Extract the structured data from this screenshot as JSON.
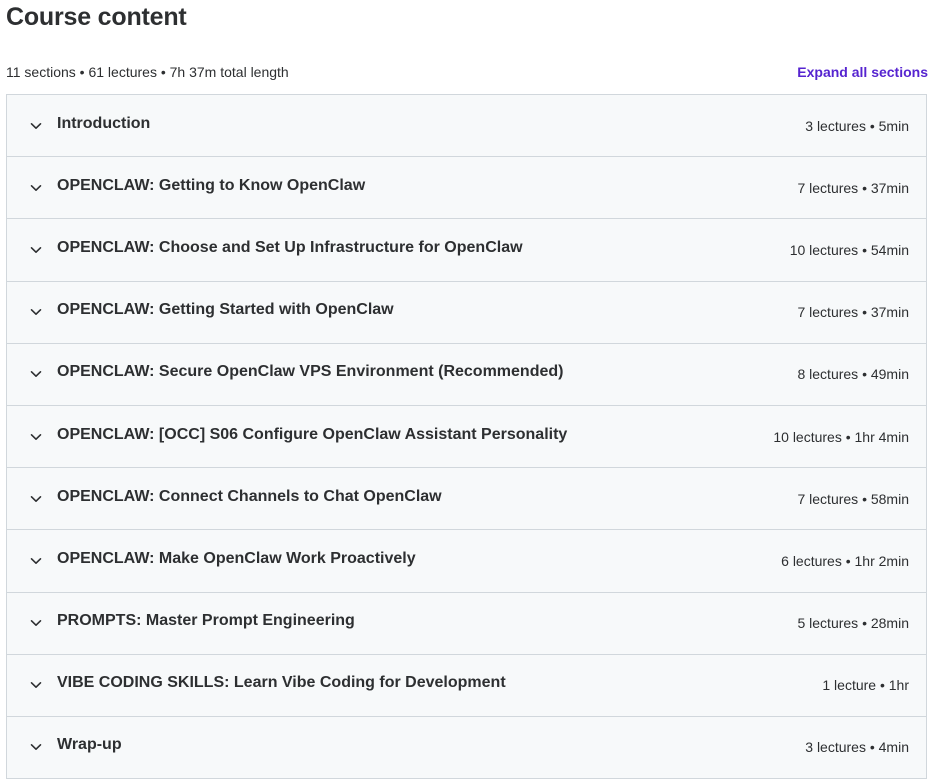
{
  "header": {
    "title": "Course content",
    "summary": "11 sections • 61 lectures • 7h 37m total length",
    "expand_label": "Expand all sections"
  },
  "colors": {
    "accent": "#5624d0",
    "section_bg": "#f7f9fa",
    "border": "#d1d7dc",
    "text": "#2d2f31"
  },
  "sections": [
    {
      "title": "Introduction",
      "meta": "3 lectures • 5min",
      "icon": "chevron-down-icon"
    },
    {
      "title": "OPENCLAW: Getting to Know OpenClaw",
      "meta": "7 lectures • 37min",
      "icon": "chevron-down-icon"
    },
    {
      "title": "OPENCLAW: Choose and Set Up Infrastructure for OpenClaw",
      "meta": "10 lectures • 54min",
      "icon": "chevron-down-icon"
    },
    {
      "title": "OPENCLAW: Getting Started with OpenClaw",
      "meta": "7 lectures • 37min",
      "icon": "chevron-down-icon"
    },
    {
      "title": "OPENCLAW: Secure OpenClaw VPS Environment (Recommended)",
      "meta": "8 lectures • 49min",
      "icon": "chevron-down-icon"
    },
    {
      "title": "OPENCLAW: [OCC] S06 Configure OpenClaw Assistant Personality",
      "meta": "10 lectures • 1hr 4min",
      "icon": "chevron-down-icon"
    },
    {
      "title": "OPENCLAW: Connect Channels to Chat OpenClaw",
      "meta": "7 lectures • 58min",
      "icon": "chevron-down-icon"
    },
    {
      "title": "OPENCLAW: Make OpenClaw Work Proactively",
      "meta": "6 lectures • 1hr 2min",
      "icon": "chevron-down-icon"
    },
    {
      "title": "PROMPTS: Master Prompt Engineering",
      "meta": "5 lectures • 28min",
      "icon": "chevron-down-icon"
    },
    {
      "title": "VIBE CODING SKILLS: Learn Vibe Coding for Development",
      "meta": "1 lecture • 1hr",
      "icon": "chevron-down-icon"
    },
    {
      "title": "Wrap-up",
      "meta": "3 lectures • 4min",
      "icon": "chevron-down-icon"
    }
  ]
}
